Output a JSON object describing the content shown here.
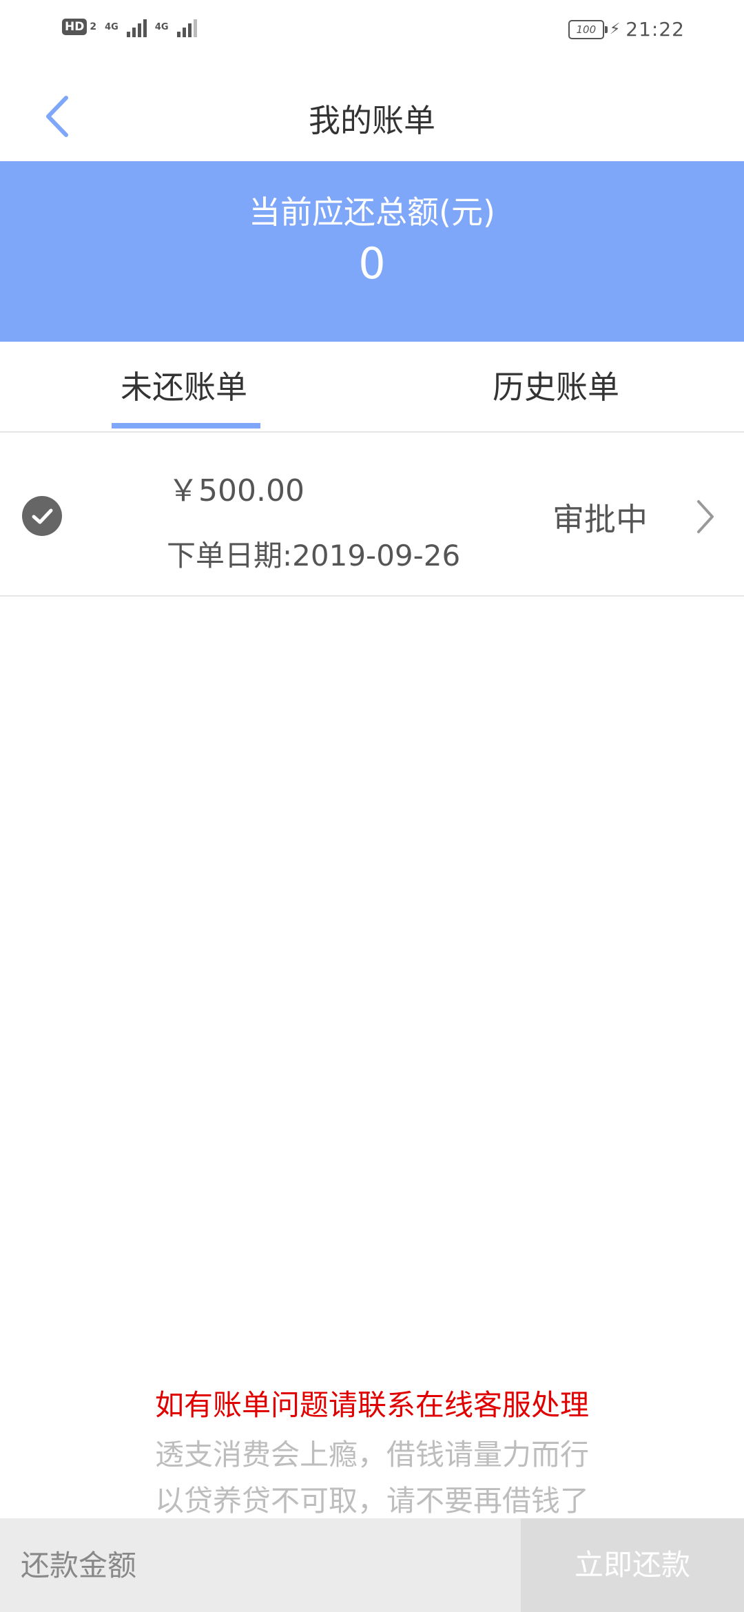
{
  "status_bar": {
    "hd_label": "HD",
    "hd_sub": "2",
    "net1": "4G",
    "net2": "4G",
    "battery": "100",
    "time": "21:22"
  },
  "header": {
    "title": "我的账单"
  },
  "summary": {
    "label": "当前应还总额(元)",
    "amount": "0",
    "color": "#7ea6f9"
  },
  "tabs": [
    {
      "label": "未还账单",
      "active": true
    },
    {
      "label": "历史账单",
      "active": false
    }
  ],
  "bills": [
    {
      "amount": "￥500.00",
      "date": "下单日期:2019-09-26",
      "status": "审批中",
      "checked": true
    }
  ],
  "notices": {
    "contact": "如有账单问题请联系在线客服处理",
    "warning1": "透支消费会上瘾，借钱请量力而行",
    "warning2": "以贷养贷不可取，请不要再借钱了",
    "contact_color": "#e00000"
  },
  "bottom_bar": {
    "amount_placeholder": "还款金额",
    "pay_label": "立即还款"
  },
  "icons": {
    "back": "back-arrow-icon",
    "check": "check-circle-icon",
    "chevron": "chevron-right-icon"
  }
}
